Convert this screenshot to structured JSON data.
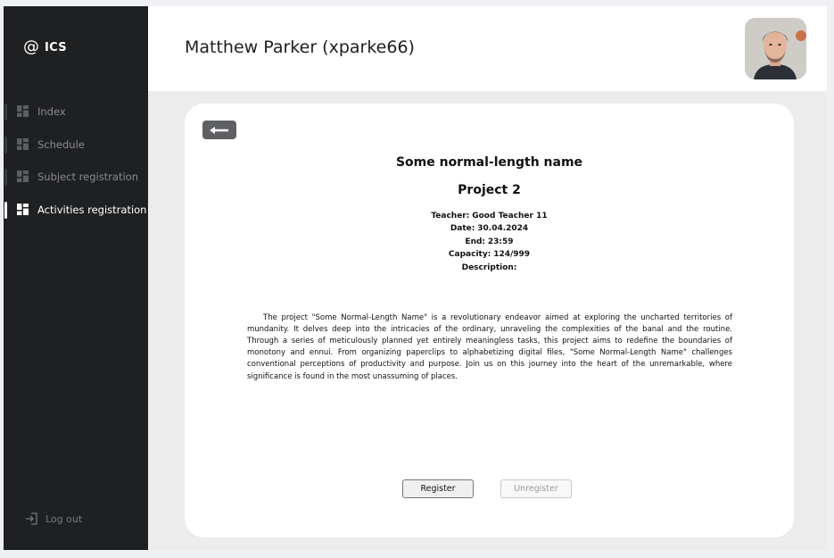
{
  "sidebar": {
    "brand": {
      "symbol": "@",
      "name": "ICS"
    },
    "items": [
      {
        "label": "Index",
        "active": false
      },
      {
        "label": "Schedule",
        "active": false
      },
      {
        "label": "Subject registration",
        "active": false
      },
      {
        "label": "Activities registration",
        "active": true
      }
    ],
    "logout_label": "Log out"
  },
  "header": {
    "user_name": "Matthew Parker (xparke66)"
  },
  "activity": {
    "title": "Some normal-length name",
    "subtitle": "Project 2",
    "teacher_label": "Teacher:",
    "teacher_value": "Good Teacher 11",
    "date_label": "Date:",
    "date_value": "30.04.2024",
    "end_label": "End:",
    "end_value": "23:59",
    "capacity_label": "Capacity:",
    "capacity_value": "124/999",
    "description_label": "Description:",
    "description": "The project \"Some Normal-Length Name\" is a revolutionary endeavor aimed at exploring the uncharted territories of mundanity. It delves deep into the intricacies of the ordinary, unraveling the complexities of the banal and the routine. Through a series of meticulously planned yet entirely meaningless tasks, this project aims to redefine the boundaries of monotony and ennui. From organizing paperclips to alphabetizing digital files, \"Some Normal-Length Name\" challenges conventional perceptions of productivity and purpose. Join us on this journey into the heart of the unremarkable, where significance is found in the most unassuming of places."
  },
  "actions": {
    "register_label": "Register",
    "unregister_label": "Unregister",
    "unregister_disabled": true
  },
  "icons": {
    "brand": "at-icon",
    "nav": "grid-icon",
    "logout": "logout-icon",
    "back": "arrow-left-icon"
  },
  "colors": {
    "sidebar_bg": "#1f2022",
    "active_text": "#ffffff",
    "inactive_text": "#8a8b8e",
    "back_button_bg": "#5f6063",
    "content_bg": "#ececec"
  }
}
